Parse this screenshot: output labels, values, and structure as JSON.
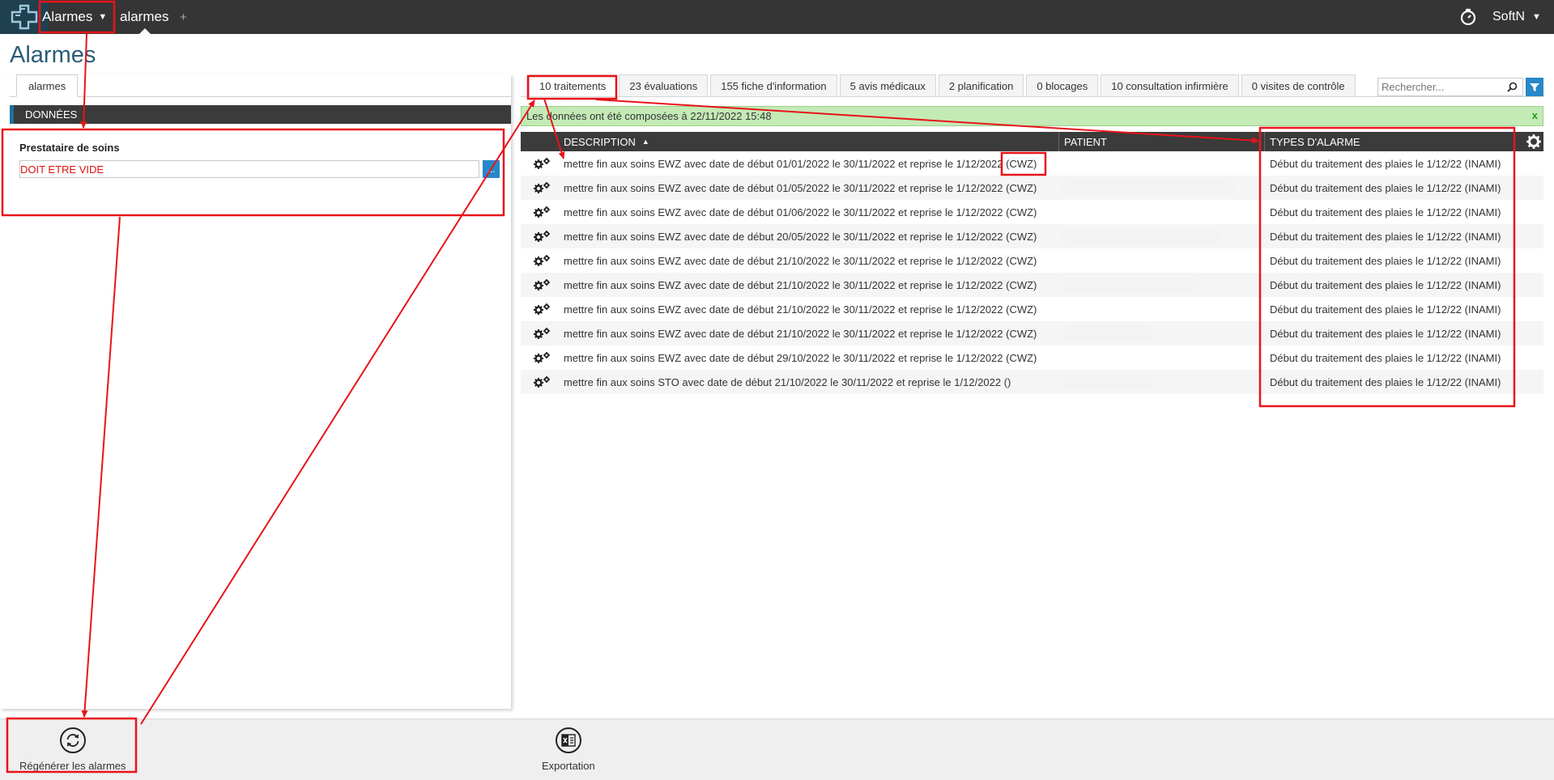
{
  "topbar": {
    "module_menu": "Alarmes",
    "tab": "alarmes",
    "add": "+",
    "user": "SoftN"
  },
  "page_title": "Alarmes",
  "left": {
    "tab": "alarmes",
    "section": "DONNÉES",
    "field_label": "Prestataire de soins",
    "field_value": "DOIT ETRE VIDE",
    "field_button": "..."
  },
  "tabs": [
    "10 traitements",
    "23 évaluations",
    "155 fiche d'information",
    "5 avis médicaux",
    "2 planification",
    "0 blocages",
    "10 consultation infirmière",
    "0 visites de contrôle"
  ],
  "search": {
    "placeholder": "Rechercher..."
  },
  "status": {
    "message": "Les données ont été composées à 22/11/2022 15:48",
    "close": "x"
  },
  "grid": {
    "columns": {
      "description": "DESCRIPTION",
      "patient": "PATIENT",
      "types": "TYPES D'ALARME"
    },
    "rows": [
      {
        "description": "mettre fin aux soins EWZ avec date de début 01/01/2022 le 30/11/2022 et reprise le 1/12/2022 (CWZ)",
        "type": "Début du traitement des plaies le 1/12/22 (INAMI)"
      },
      {
        "description": "mettre fin aux soins EWZ avec date de début 01/05/2022 le 30/11/2022 et reprise le 1/12/2022 (CWZ)",
        "type": "Début du traitement des plaies le 1/12/22 (INAMI)"
      },
      {
        "description": "mettre fin aux soins EWZ avec date de début 01/06/2022 le 30/11/2022 et reprise le 1/12/2022 (CWZ)",
        "type": "Début du traitement des plaies le 1/12/22 (INAMI)"
      },
      {
        "description": "mettre fin aux soins EWZ avec date de début 20/05/2022 le 30/11/2022 et reprise le 1/12/2022 (CWZ)",
        "type": "Début du traitement des plaies le 1/12/22 (INAMI)"
      },
      {
        "description": "mettre fin aux soins EWZ avec date de début 21/10/2022 le 30/11/2022 et reprise le 1/12/2022 (CWZ)",
        "type": "Début du traitement des plaies le 1/12/22 (INAMI)"
      },
      {
        "description": "mettre fin aux soins EWZ avec date de début 21/10/2022 le 30/11/2022 et reprise le 1/12/2022 (CWZ)",
        "type": "Début du traitement des plaies le 1/12/22 (INAMI)"
      },
      {
        "description": "mettre fin aux soins EWZ avec date de début 21/10/2022 le 30/11/2022 et reprise le 1/12/2022 (CWZ)",
        "type": "Début du traitement des plaies le 1/12/22 (INAMI)"
      },
      {
        "description": "mettre fin aux soins EWZ avec date de début 21/10/2022 le 30/11/2022 et reprise le 1/12/2022 (CWZ)",
        "type": "Début du traitement des plaies le 1/12/22 (INAMI)"
      },
      {
        "description": "mettre fin aux soins EWZ avec date de début 29/10/2022 le 30/11/2022 et reprise le 1/12/2022 (CWZ)",
        "type": "Début du traitement des plaies le 1/12/22 (INAMI)"
      },
      {
        "description": "mettre fin aux soins STO avec date de début 21/10/2022 le 30/11/2022 et reprise le 1/12/2022 ()",
        "type": "Début du traitement des plaies le 1/12/22 (INAMI)"
      }
    ]
  },
  "bottom": {
    "regenerate": "Régénérer les alarmes",
    "export": "Exportation"
  },
  "colors": {
    "accent": "#2787c9",
    "title": "#2a5d78",
    "annotation": "#e8141a",
    "status_bg": "#c4eab6"
  }
}
